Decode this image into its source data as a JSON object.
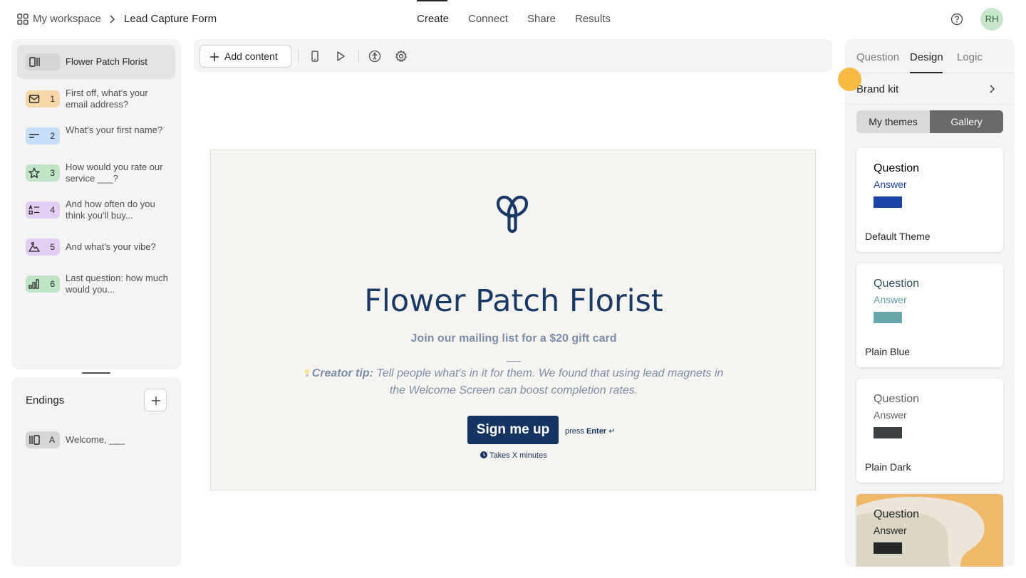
{
  "header": {
    "workspace_label": "My workspace",
    "form_name": "Lead Capture Form",
    "tabs": [
      "Create",
      "Connect",
      "Share",
      "Results"
    ],
    "active_tab": "Create",
    "avatar_initials": "RH"
  },
  "sidebar": {
    "welcome": {
      "label": "Flower Patch Florist",
      "icon": "welcome-screen-icon"
    },
    "questions": [
      {
        "number": "1",
        "text": "First off, what's your email address?",
        "icon": "email-icon",
        "color": "#f6d7a7"
      },
      {
        "number": "2",
        "text": "What's your first name?",
        "icon": "short-text-icon",
        "color": "#c6defa"
      },
      {
        "number": "3",
        "text": "How would you rate our service ___?",
        "icon": "star-icon",
        "color": "#bfe5c6"
      },
      {
        "number": "4",
        "text": "And how often do you think you'll buy...",
        "icon": "multiple-choice-icon",
        "color": "#e3cdf3"
      },
      {
        "number": "5",
        "text": "And what's your vibe?",
        "icon": "picture-choice-icon",
        "color": "#e3cdf3"
      },
      {
        "number": "6",
        "text": "Last question: how much would you...",
        "icon": "opinion-scale-icon",
        "color": "#bfe5c6"
      }
    ],
    "endings_title": "Endings",
    "endings": [
      {
        "letter": "A",
        "text": "Welcome, ___",
        "icon": "ending-screen-icon"
      }
    ]
  },
  "toolbar": {
    "add_content_label": "Add content"
  },
  "preview": {
    "title": "Flower Patch Florist",
    "subtitle": "Join our mailing list for a $20 gift card",
    "tip_label": "Creator tip:",
    "tip_text": "Tell people what's in it for them. We found that using lead magnets in the Welcome Screen can boost completion rates.",
    "button_label": "Sign me up",
    "press_label": "press",
    "enter_label": "Enter",
    "enter_glyph": "↵",
    "time_label": "Takes X minutes",
    "title_color": "#183866",
    "button_color": "#163461"
  },
  "design_panel": {
    "tabs": [
      "Question",
      "Design",
      "Logic"
    ],
    "active_tab": "Design",
    "brand_kit_label": "Brand kit",
    "segments": [
      "My themes",
      "Gallery"
    ],
    "active_segment": "Gallery",
    "themes": [
      {
        "question": "Question",
        "answer": "Answer",
        "name": "Default Theme",
        "answer_color": "#1d44a8",
        "swatch": "#1d44a8",
        "question_color": "#000000"
      },
      {
        "question": "Question",
        "answer": "Answer",
        "name": "Plain Blue",
        "answer_color": "#5d9ea3",
        "swatch": "#69a8aa",
        "question_color": "#304e5c"
      },
      {
        "question": "Question",
        "answer": "Answer",
        "name": "Plain Dark",
        "answer_color": "#5f6468",
        "swatch": "#3c4146",
        "question_color": "#5f6468"
      },
      {
        "question": "Question",
        "answer": "Answer",
        "name": "",
        "answer_color": "#262627",
        "swatch": "#262627",
        "question_color": "#262627"
      }
    ]
  }
}
